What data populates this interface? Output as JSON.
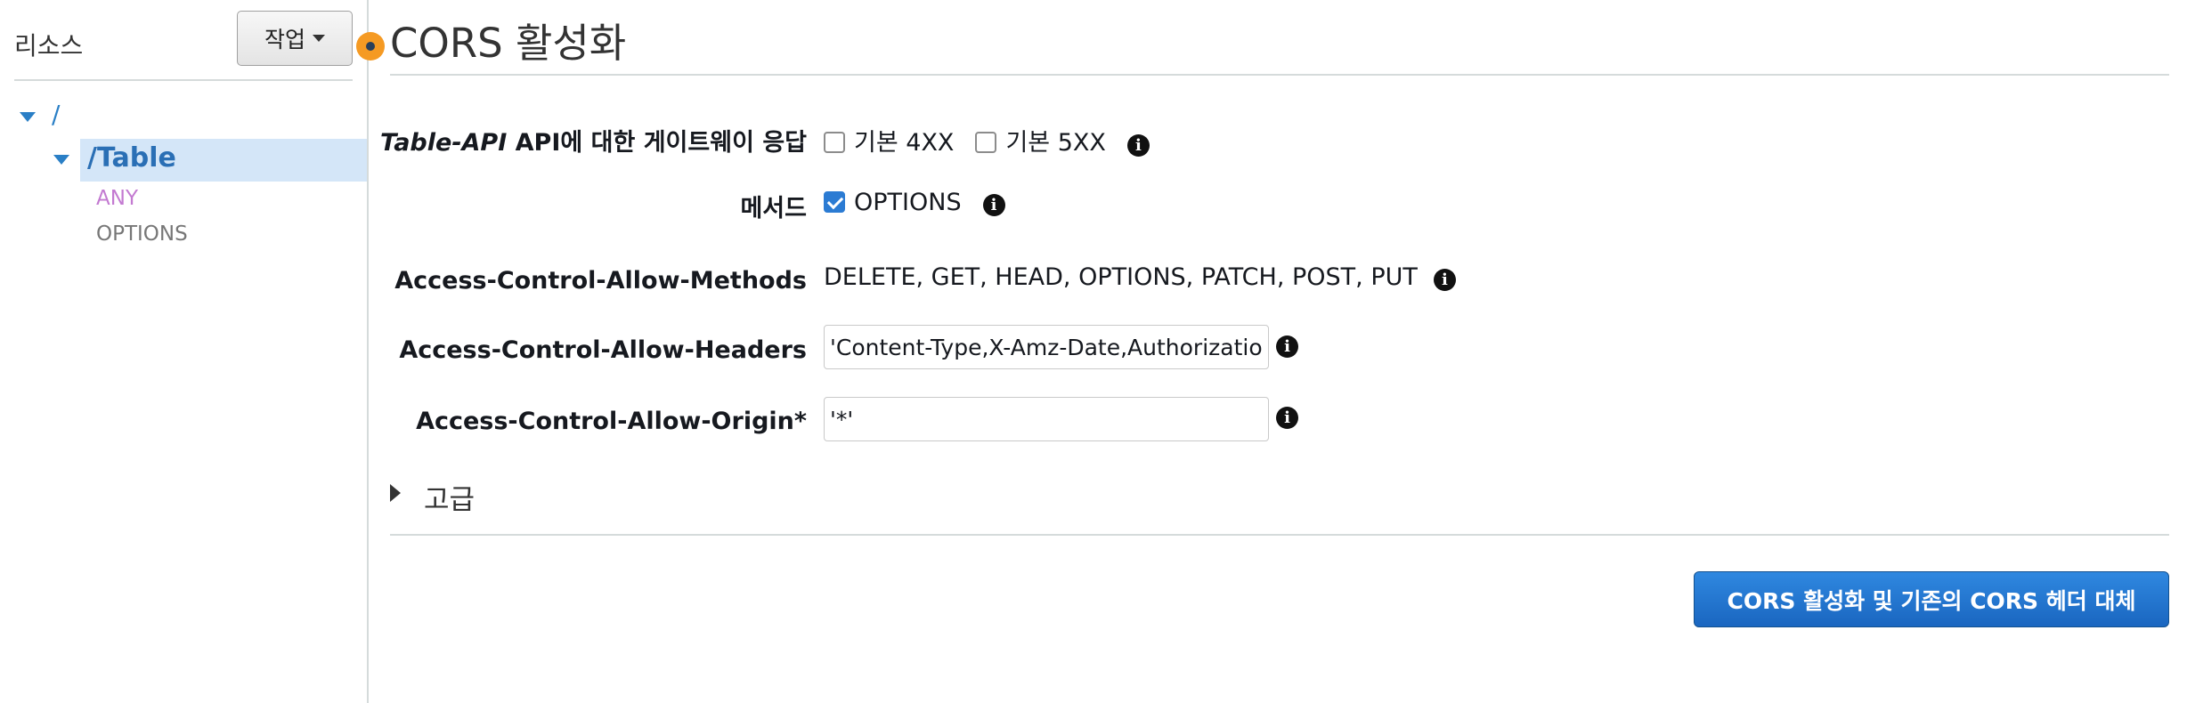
{
  "sidebar": {
    "title": "리소스",
    "actions_label": "작업",
    "tree": {
      "root": "/",
      "resource": "/Table",
      "methods": [
        "ANY",
        "OPTIONS"
      ]
    }
  },
  "main": {
    "title": "CORS 활성화",
    "gateway": {
      "label_api": "Table-API",
      "label_rest": " API에 대한 게이트웨이 응답",
      "options": [
        {
          "label": "기본 4XX",
          "checked": false
        },
        {
          "label": "기본 5XX",
          "checked": false
        }
      ]
    },
    "methods": {
      "label": "메서드",
      "options": [
        {
          "label": "OPTIONS",
          "checked": true
        }
      ]
    },
    "allow_methods": {
      "label": "Access-Control-Allow-Methods",
      "value": "DELETE, GET, HEAD, OPTIONS, PATCH, POST, PUT"
    },
    "allow_headers": {
      "label": "Access-Control-Allow-Headers",
      "value": "'Content-Type,X-Amz-Date,Authorization,"
    },
    "allow_origin": {
      "label": "Access-Control-Allow-Origin*",
      "value": "'*'"
    },
    "advanced_label": "고급",
    "submit_label": "CORS 활성화 및 기존의 CORS 헤더 대체"
  },
  "icons": {
    "info": "info-icon",
    "caret": "caret-down-icon",
    "tree_toggle": "tree-expand-icon",
    "advanced_toggle": "caret-right-icon"
  },
  "colors": {
    "primary_button": "#1a66c0",
    "link": "#2a7fc6",
    "selection": "#d4e6f8",
    "marker": "#f59a23",
    "method_any": "#c37ad1"
  }
}
